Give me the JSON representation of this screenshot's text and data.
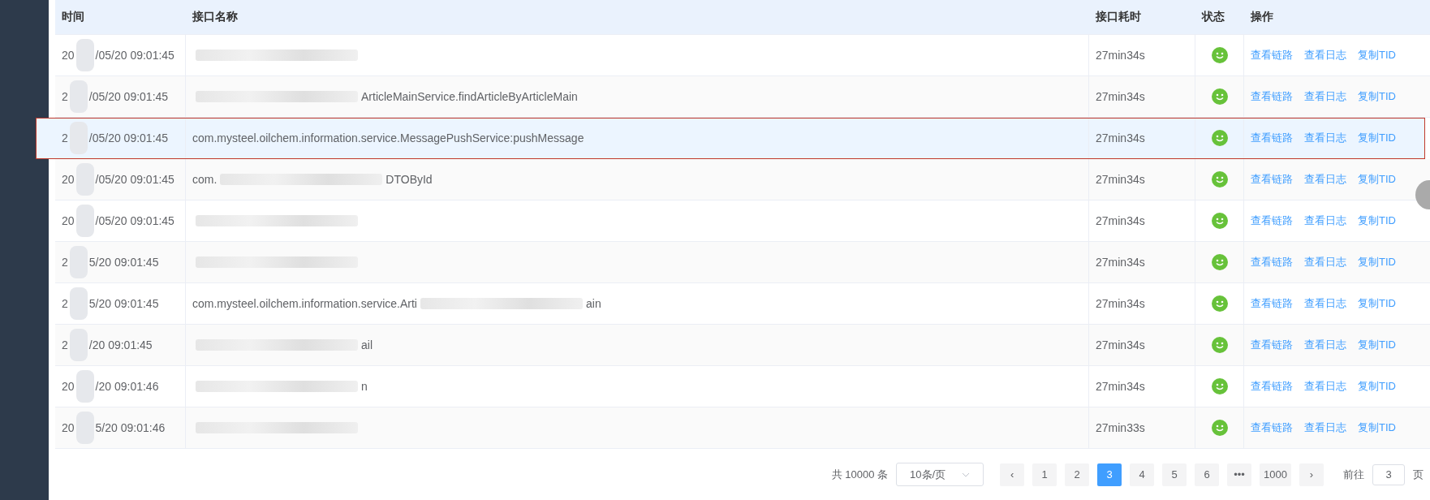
{
  "table": {
    "columns": [
      "时间",
      "接口名称",
      "接口耗时",
      "状态",
      "操作"
    ],
    "rows": [
      {
        "time_start": "20",
        "time_end": "/05/20 09:01:45",
        "name_segments": [
          {
            "kind": "blur"
          }
        ],
        "duration": "27min34s",
        "status_ok": true,
        "actions": [
          "查看链路",
          "查看日志",
          "复制TID"
        ],
        "selected": false
      },
      {
        "time_start": "2",
        "time_end": "/05/20 09:01:45",
        "name_segments": [
          {
            "kind": "blur"
          },
          {
            "kind": "text",
            "text": "ArticleMainService.findArticleByArticleMain"
          }
        ],
        "duration": "27min34s",
        "status_ok": true,
        "actions": [
          "查看链路",
          "查看日志",
          "复制TID"
        ],
        "selected": false
      },
      {
        "time_start": "2",
        "time_end": "/05/20 09:01:45",
        "name_segments": [
          {
            "kind": "text",
            "text": "com.mysteel.oilchem.information.service.MessagePushService:pushMessage"
          }
        ],
        "duration": "27min34s",
        "status_ok": true,
        "actions": [
          "查看链路",
          "查看日志",
          "复制TID"
        ],
        "selected": true
      },
      {
        "time_start": "20",
        "time_end": "/05/20 09:01:45",
        "name_segments": [
          {
            "kind": "text",
            "text": "com."
          },
          {
            "kind": "blur"
          },
          {
            "kind": "text",
            "text": "DTOById"
          }
        ],
        "duration": "27min34s",
        "status_ok": true,
        "actions": [
          "查看链路",
          "查看日志",
          "复制TID"
        ],
        "selected": false
      },
      {
        "time_start": "20",
        "time_end": "/05/20 09:01:45",
        "name_segments": [
          {
            "kind": "blur"
          }
        ],
        "duration": "27min34s",
        "status_ok": true,
        "actions": [
          "查看链路",
          "查看日志",
          "复制TID"
        ],
        "selected": false
      },
      {
        "time_start": "2",
        "time_end": "5/20 09:01:45",
        "name_segments": [
          {
            "kind": "blur"
          }
        ],
        "duration": "27min34s",
        "status_ok": true,
        "actions": [
          "查看链路",
          "查看日志",
          "复制TID"
        ],
        "selected": false
      },
      {
        "time_start": "2",
        "time_end": "5/20 09:01:45",
        "name_segments": [
          {
            "kind": "text",
            "text": "com.mysteel.oilchem.information.service.Arti"
          },
          {
            "kind": "blur"
          },
          {
            "kind": "text",
            "text": "ain"
          }
        ],
        "duration": "27min34s",
        "status_ok": true,
        "actions": [
          "查看链路",
          "查看日志",
          "复制TID"
        ],
        "selected": false
      },
      {
        "time_start": "2",
        "time_end": "/20 09:01:45",
        "name_segments": [
          {
            "kind": "blur"
          },
          {
            "kind": "text",
            "text": "ail"
          }
        ],
        "duration": "27min34s",
        "status_ok": true,
        "actions": [
          "查看链路",
          "查看日志",
          "复制TID"
        ],
        "selected": false
      },
      {
        "time_start": "20",
        "time_end": "/20 09:01:46",
        "name_segments": [
          {
            "kind": "blur"
          },
          {
            "kind": "text",
            "text": "n"
          }
        ],
        "duration": "27min34s",
        "status_ok": true,
        "actions": [
          "查看链路",
          "查看日志",
          "复制TID"
        ],
        "selected": false
      },
      {
        "time_start": "20",
        "time_end": "5/20 09:01:46",
        "name_segments": [
          {
            "kind": "blur"
          }
        ],
        "duration": "27min33s",
        "status_ok": true,
        "actions": [
          "查看链路",
          "查看日志",
          "复制TID"
        ],
        "selected": false
      }
    ]
  },
  "pagination": {
    "total": "共 10000 条",
    "page_size": "10条/页",
    "prev": "‹",
    "next": "›",
    "pages": [
      {
        "label": "1",
        "selected": false
      },
      {
        "label": "2",
        "selected": false
      },
      {
        "label": "3",
        "selected": true
      },
      {
        "label": "4",
        "selected": false
      },
      {
        "label": "5",
        "selected": false
      },
      {
        "label": "6",
        "selected": false
      },
      {
        "label": "•••",
        "selected": false
      },
      {
        "label": "1000",
        "selected": false
      }
    ],
    "goto_label": "前往",
    "goto_value": "3",
    "goto_unit": "页"
  }
}
